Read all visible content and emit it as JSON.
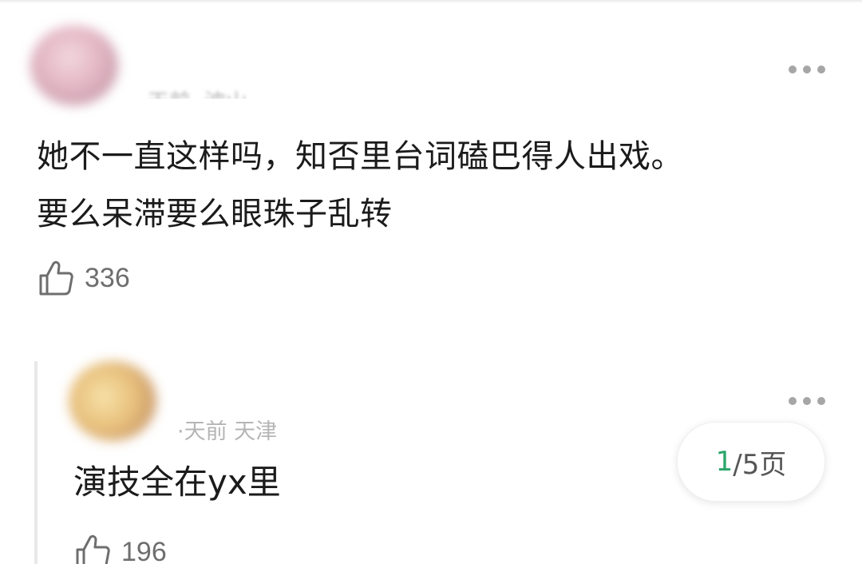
{
  "main_comment": {
    "username": "",
    "meta": "·天前 ·波山",
    "text_line1": "她不一直这样吗，知否里台词磕巴得人出戏。",
    "text_line2": "要么呆滞要么眼珠子乱转",
    "likes": "336"
  },
  "reply": {
    "username": "",
    "meta": "·天前 天津",
    "text": "演技全在yx里",
    "likes": "196"
  },
  "pager": {
    "current": "1",
    "separator_total": "/5页"
  },
  "colors": {
    "accent": "#2aa66a",
    "text": "#1b1b1b",
    "muted": "#6e6e6e"
  },
  "icons": {
    "like": "thumbs-up-outline-icon",
    "more": "more-dots-icon"
  }
}
